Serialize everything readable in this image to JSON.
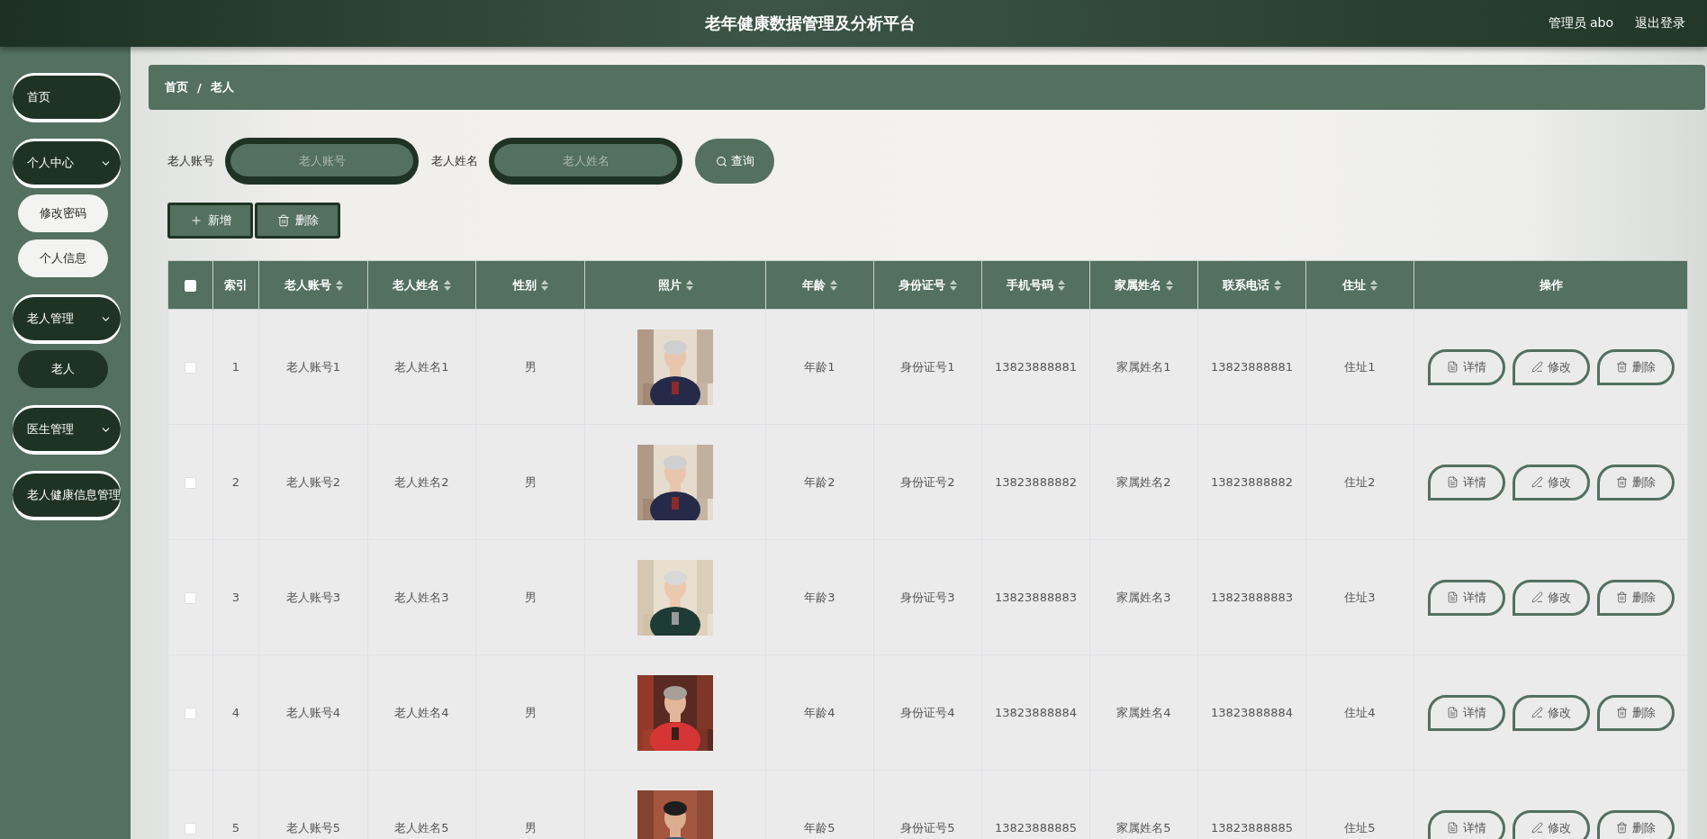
{
  "header": {
    "title": "老年健康数据管理及分析平台",
    "user": "管理员 abo",
    "logout": "退出登录"
  },
  "sidebar": {
    "items": [
      {
        "kind": "link",
        "label": "首页"
      },
      {
        "kind": "group",
        "label": "个人中心",
        "children": [
          {
            "label": "修改密码",
            "selected": false
          },
          {
            "label": "个人信息",
            "selected": false
          }
        ]
      },
      {
        "kind": "group",
        "label": "老人管理",
        "children": [
          {
            "label": "老人",
            "selected": true
          }
        ]
      },
      {
        "kind": "group",
        "label": "医生管理"
      },
      {
        "kind": "link",
        "label": "老人健康信息管理"
      }
    ]
  },
  "breadcrumb": {
    "items": [
      "首页",
      "老人"
    ],
    "separator": "/"
  },
  "search": {
    "fields": [
      {
        "label": "老人账号",
        "placeholder": "老人账号"
      },
      {
        "label": "老人姓名",
        "placeholder": "老人姓名"
      }
    ],
    "button": "查询"
  },
  "actions": [
    {
      "kind": "add",
      "label": "新增"
    },
    {
      "kind": "delete",
      "label": "删除"
    }
  ],
  "table": {
    "select_all": {
      "checked": false
    },
    "columns": [
      {
        "label": "索引",
        "sortable": false
      },
      {
        "label": "老人账号",
        "sortable": true
      },
      {
        "label": "老人姓名",
        "sortable": true
      },
      {
        "label": "性别",
        "sortable": true
      },
      {
        "label": "照片",
        "sortable": true
      },
      {
        "label": "年龄",
        "sortable": true
      },
      {
        "label": "身份证号",
        "sortable": true
      },
      {
        "label": "手机号码",
        "sortable": true
      },
      {
        "label": "家属姓名",
        "sortable": true
      },
      {
        "label": "联系电话",
        "sortable": true
      },
      {
        "label": "住址",
        "sortable": true
      },
      {
        "label": "操作",
        "sortable": false
      }
    ],
    "rows": [
      {
        "checked": false,
        "cells": [
          "1",
          "老人账号1",
          "老人姓名1",
          "男",
          {
            "kind": "picture"
          },
          "年龄1",
          "身份证号1",
          "13823888881",
          "家属姓名1",
          "13823888881",
          "住址1"
        ],
        "actions": [
          {
            "kind": "detail",
            "label": "详情"
          },
          {
            "kind": "edit",
            "label": "修改"
          },
          {
            "kind": "delete",
            "label": "删除"
          }
        ]
      },
      {
        "checked": false,
        "cells": [
          "2",
          "老人账号2",
          "老人姓名2",
          "男",
          {
            "kind": "picture"
          },
          "年龄2",
          "身份证号2",
          "13823888882",
          "家属姓名2",
          "13823888882",
          "住址2"
        ],
        "actions": [
          {
            "kind": "detail",
            "label": "详情"
          },
          {
            "kind": "edit",
            "label": "修改"
          },
          {
            "kind": "delete",
            "label": "删除"
          }
        ]
      },
      {
        "checked": false,
        "cells": [
          "3",
          "老人账号3",
          "老人姓名3",
          "男",
          {
            "kind": "picture"
          },
          "年龄3",
          "身份证号3",
          "13823888883",
          "家属姓名3",
          "13823888883",
          "住址3"
        ],
        "actions": [
          {
            "kind": "detail",
            "label": "详情"
          },
          {
            "kind": "edit",
            "label": "修改"
          },
          {
            "kind": "delete",
            "label": "删除"
          }
        ]
      },
      {
        "checked": false,
        "cells": [
          "4",
          "老人账号4",
          "老人姓名4",
          "男",
          {
            "kind": "picture"
          },
          "年龄4",
          "身份证号4",
          "13823888884",
          "家属姓名4",
          "13823888884",
          "住址4"
        ],
        "actions": [
          {
            "kind": "detail",
            "label": "详情"
          },
          {
            "kind": "edit",
            "label": "修改"
          },
          {
            "kind": "delete",
            "label": "删除"
          }
        ]
      },
      {
        "checked": false,
        "cells": [
          "5",
          "老人账号5",
          "老人姓名5",
          "男",
          {
            "kind": "picture"
          },
          "年龄5",
          "身份证号5",
          "13823888885",
          "家属姓名5",
          "13823888885",
          "住址5"
        ],
        "actions": [
          {
            "kind": "detail",
            "label": "详情"
          },
          {
            "kind": "edit",
            "label": "修改"
          },
          {
            "kind": "delete",
            "label": "删除"
          }
        ]
      }
    ]
  }
}
